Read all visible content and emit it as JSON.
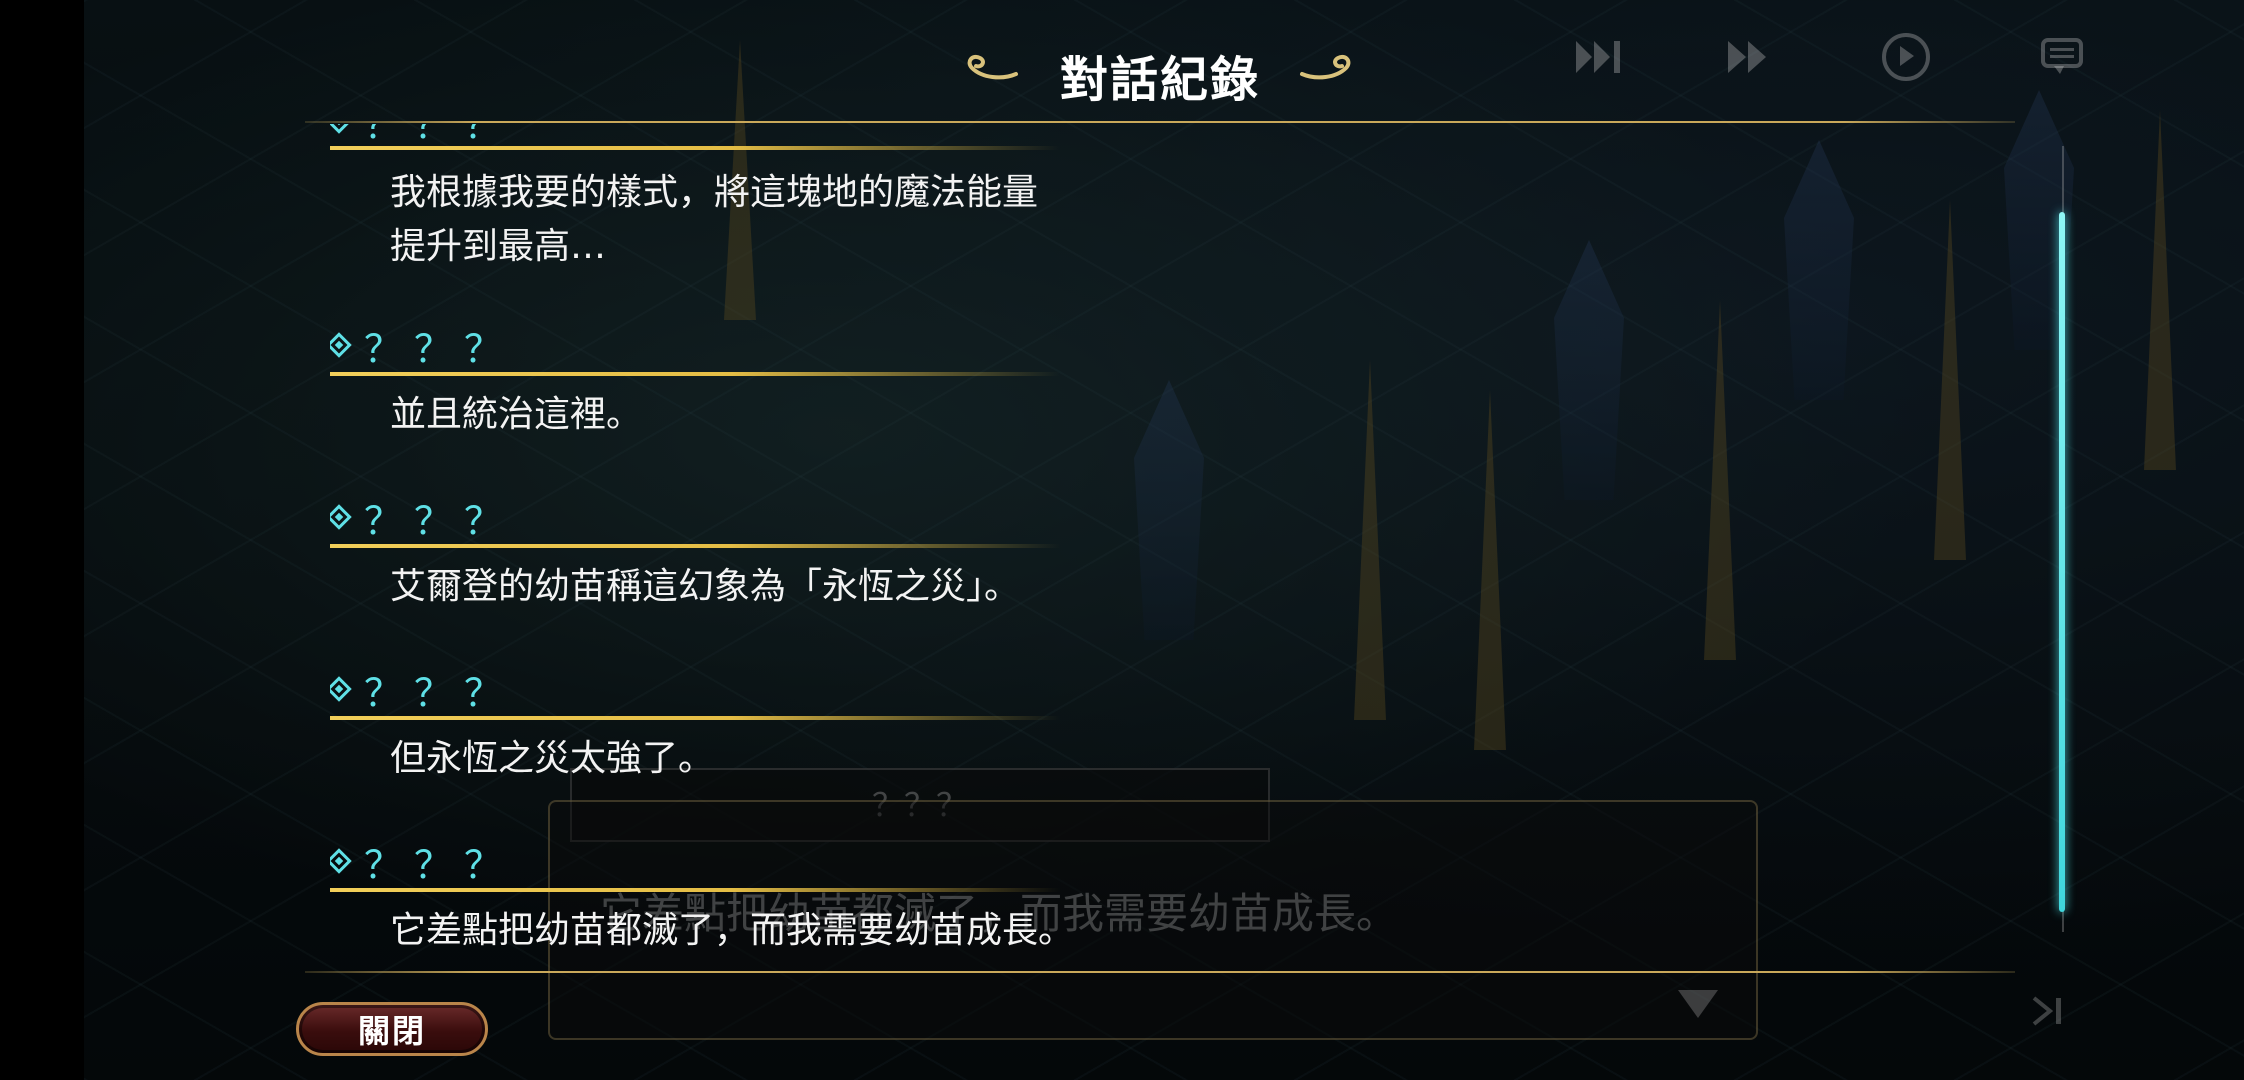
{
  "log": {
    "title": "對話紀錄",
    "entries": [
      {
        "speaker": "？？？",
        "lines": [
          "我根據我要的樣式，將這塊地的魔法能量",
          "提升到最高…"
        ]
      },
      {
        "speaker": "？？？",
        "lines": [
          "並且統治這裡。"
        ]
      },
      {
        "speaker": "？？？",
        "lines": [
          "艾爾登的幼苗稱這幻象為「永恆之災」。"
        ]
      },
      {
        "speaker": "？？？",
        "lines": [
          "但永恆之災太強了。"
        ]
      },
      {
        "speaker": "？？？",
        "lines": [
          "它差點把幼苗都滅了，而我需要幼苗成長。"
        ]
      }
    ],
    "close_label": "關閉",
    "scroll_position": 0.98
  },
  "background_dialog": {
    "speaker": "？？？",
    "text": "它差點把幼苗都滅了，而我需要幼苗成長。"
  },
  "hud": {
    "icons": [
      "skip-end-icon",
      "fast-forward-icon",
      "auto-play-icon",
      "log-menu-icon"
    ]
  },
  "colors": {
    "speaker": "#5fe0e6",
    "rule_gold": "#e4bd45",
    "frame_gold": "#c9a85a",
    "scroll_thumb": "#3fd6dc",
    "close_button": "#3a0d0d"
  }
}
